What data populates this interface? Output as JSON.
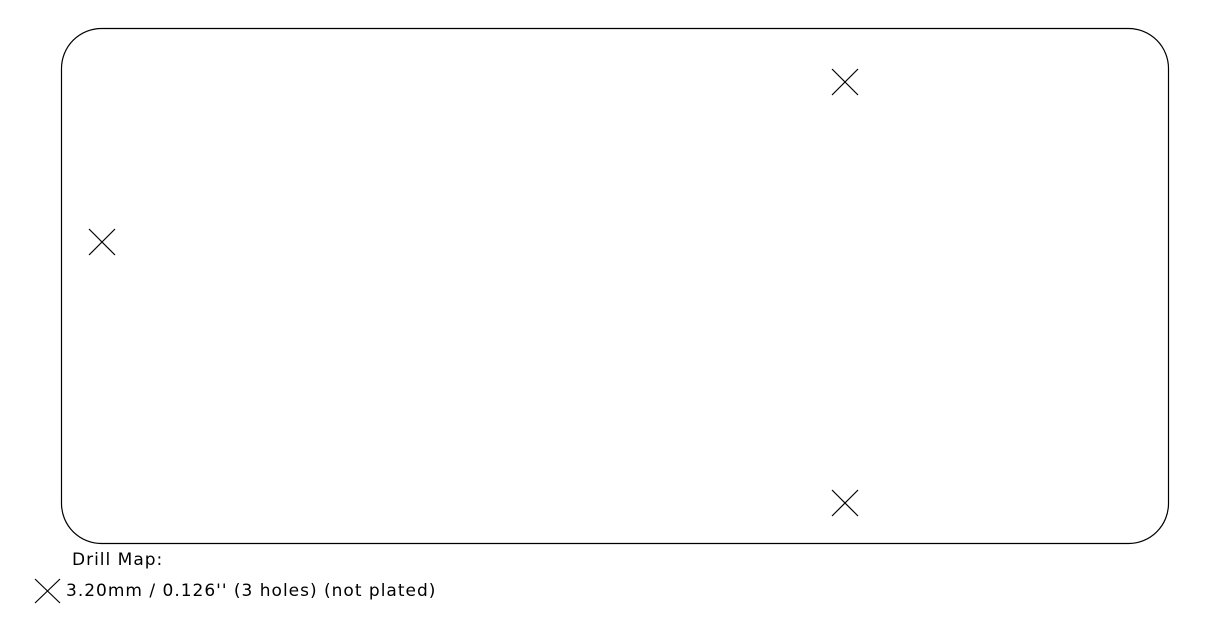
{
  "legend": {
    "title": "Drill Map:",
    "entry": "3.20mm / 0.126'' (3 holes) (not plated)",
    "symbol": "cross-icon"
  },
  "drill_holes": {
    "count": 3,
    "plated": false
  },
  "colors": {
    "stroke": "#000000",
    "background": "#ffffff"
  }
}
